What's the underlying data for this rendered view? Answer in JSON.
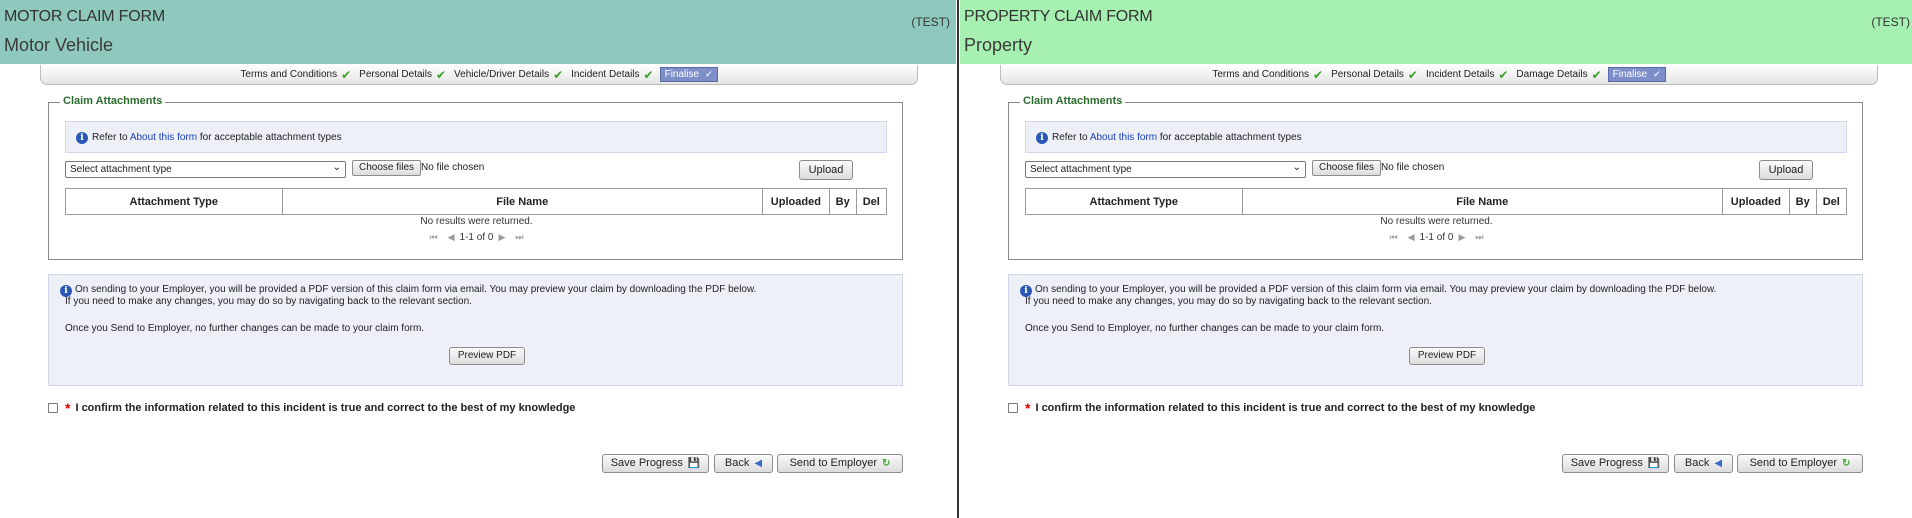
{
  "panels": [
    {
      "title": "MOTOR CLAIM FORM",
      "subtitle": "Motor Vehicle",
      "test_tag": "(TEST)",
      "steps": [
        "Terms and Conditions",
        "Personal Details",
        "Vehicle/Driver Details",
        "Incident Details"
      ],
      "active_step": "Finalise"
    },
    {
      "title": "PROPERTY CLAIM FORM",
      "subtitle": "Property",
      "test_tag": "(TEST)",
      "steps": [
        "Terms and Conditions",
        "Personal Details",
        "Incident Details",
        "Damage Details"
      ],
      "active_step": "Finalise"
    }
  ],
  "attachments": {
    "legend": "Claim Attachments",
    "info_prefix": "Refer to ",
    "info_link": "About this form",
    "info_suffix": " for acceptable attachment types",
    "select_value": "Select attachment type",
    "choose_button": "Choose files",
    "no_file": "No file chosen",
    "upload_button": "Upload",
    "columns": [
      "Attachment Type",
      "File Name",
      "Uploaded",
      "By",
      "Del"
    ],
    "no_results": "No results were returned.",
    "pager": "1-1 of 0"
  },
  "notice": {
    "line1": "On sending to your Employer, you will be provided a PDF version of this claim form via email. You may preview your claim by downloading the PDF below.",
    "line2": "If you need to make any changes, you may do so by navigating back to the relevant section.",
    "line3": "Once you Send to Employer, no further changes can be made to your claim form.",
    "preview_button": "Preview PDF"
  },
  "confirm": {
    "required_marker": "*",
    "text": "I confirm the information related to this incident is true and correct to the best of my knowledge"
  },
  "actions": {
    "save": "Save Progress",
    "back": "Back",
    "send": "Send to Employer"
  },
  "colors": {
    "motor_header": "#8fc9bd",
    "property_header": "#a6f0b2",
    "active_step": "#7d8ec9",
    "legend": "#2e6b2e",
    "check": "#3aa02a"
  },
  "icons": {
    "step_done": "green-check-icon",
    "info": "info-icon",
    "save": "floppy-disk-icon",
    "back": "back-arrow-icon",
    "send": "refresh-arrow-icon"
  }
}
